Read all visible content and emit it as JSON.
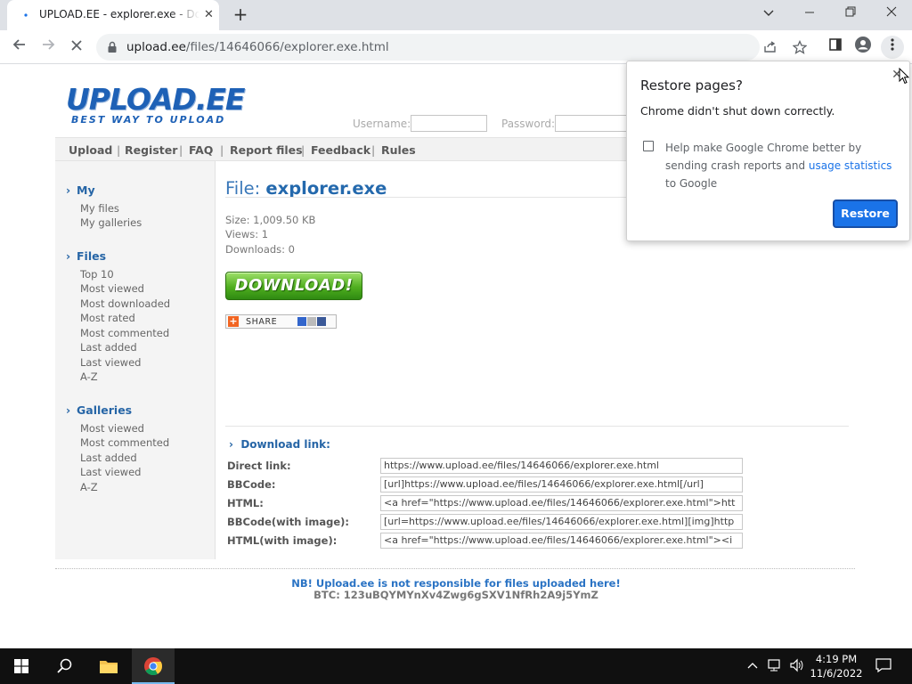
{
  "browser": {
    "tab_title": "UPLOAD.EE - explorer.exe - Download",
    "url_host": "upload.ee",
    "url_path": "/files/14646066/explorer.exe.html"
  },
  "site": {
    "logo": "UPLOAD.EE",
    "tagline": "BEST WAY TO UPLOAD",
    "username_label": "Username:",
    "password_label": "Password:"
  },
  "nav": [
    "Upload",
    "Register",
    "FAQ",
    "Report files",
    "Feedback",
    "Rules"
  ],
  "nav_separator": "|",
  "sidebar": {
    "my_heading": "My",
    "my_items": [
      "My files",
      "My galleries"
    ],
    "files_heading": "Files",
    "files_items": [
      "Top 10",
      "Most viewed",
      "Most downloaded",
      "Most rated",
      "Most commented",
      "Last added",
      "Last viewed",
      "A-Z"
    ],
    "galleries_heading": "Galleries",
    "galleries_items": [
      "Most viewed",
      "Most commented",
      "Last added",
      "Last viewed",
      "A-Z"
    ]
  },
  "file": {
    "title_prefix": "File:",
    "name": "explorer.exe",
    "size": "Size: 1,009.50 KB",
    "views": "Views: 1",
    "downloads": "Downloads: 0",
    "download_button": "DOWNLOAD!",
    "share_label": "SHARE"
  },
  "download_links": {
    "heading": "Download link:",
    "rows": [
      {
        "label": "Direct link:",
        "value": "https://www.upload.ee/files/14646066/explorer.exe.html"
      },
      {
        "label": "BBCode:",
        "value": "[url]https://www.upload.ee/files/14646066/explorer.exe.html[/url]"
      },
      {
        "label": "HTML:",
        "value": "<a href=\"https://www.upload.ee/files/14646066/explorer.exe.html\">htt"
      },
      {
        "label": "BBCode(with image):",
        "value": "[url=https://www.upload.ee/files/14646066/explorer.exe.html][img]http"
      },
      {
        "label": "HTML(with image):",
        "value": "<a href=\"https://www.upload.ee/files/14646066/explorer.exe.html\"><i"
      }
    ]
  },
  "footer": {
    "notice": "NB! Upload.ee is not responsible for files uploaded here!",
    "btc": "BTC: 123uBQYMYnXv4Zwg6gSXV1NfRh2A9j5YmZ"
  },
  "restore_popup": {
    "title": "Restore pages?",
    "message": "Chrome didn't shut down correctly.",
    "help_prefix": "Help make Google Chrome better by sending crash reports and ",
    "help_link": "usage statistics",
    "help_suffix": " to Google",
    "restore_button": "Restore"
  },
  "taskbar": {
    "time": "4:19 PM",
    "date": "11/6/2022"
  },
  "colors": {
    "accent_blue": "#1a73e8",
    "site_blue": "#2665a6",
    "download_green": "#4fae1f"
  }
}
